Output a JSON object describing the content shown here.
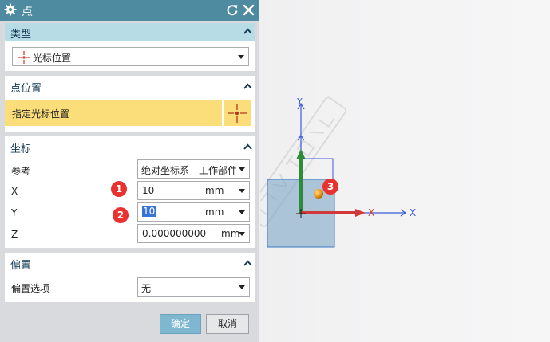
{
  "dialog": {
    "title": "点",
    "icons": {
      "settings": "gear-icon",
      "reset": "reset-icon",
      "close": "close-icon"
    }
  },
  "type_section": {
    "header": "类型",
    "dropdown_value": "光标位置",
    "dropdown_icon": "cursor-point-icon"
  },
  "point_location": {
    "header": "点位置",
    "specify_label": "指定光标位置",
    "highlight_color": "#fbde7a"
  },
  "coordinates": {
    "header": "坐标",
    "reference_label": "参考",
    "reference_value": "绝对坐标系 - 工作部件",
    "x_label": "X",
    "x_value": "10",
    "x_unit": "mm",
    "y_label": "Y",
    "y_value": "10",
    "y_unit": "mm",
    "z_label": "Z",
    "z_value": "0.000000000",
    "z_unit": "mm"
  },
  "offset": {
    "header": "偏置",
    "option_label": "偏置选项",
    "option_value": "无"
  },
  "buttons": {
    "ok": "确定",
    "cancel": "取消"
  },
  "badges": [
    "1",
    "2",
    "3"
  ],
  "viewport": {
    "axis_labels": {
      "y": "Y",
      "x_red": "X",
      "x_blue": "X"
    },
    "colors": {
      "x_axis": "#d23a3a",
      "y_axis": "#2e8b3a",
      "wcs": "#3a5bdc",
      "point": "#f0a020",
      "face": "#7fa7c7"
    },
    "watermark": "软件自学网"
  }
}
